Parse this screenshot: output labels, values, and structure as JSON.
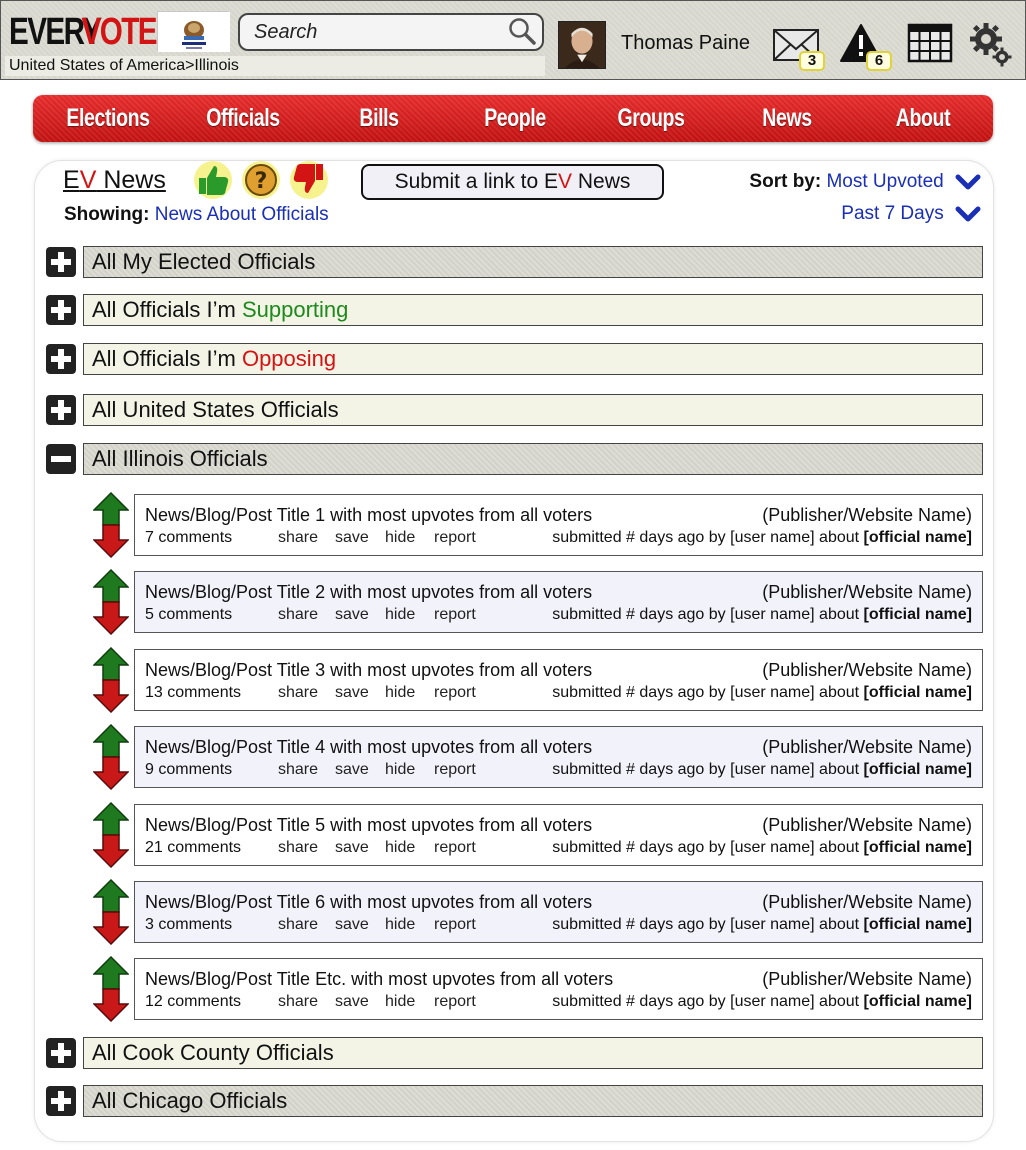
{
  "header": {
    "logo_every": "EVERY",
    "logo_vote": "VOTE",
    "breadcrumb": "United States of America>Illinois",
    "search_placeholder": "Search",
    "user_name": "Thomas Paine",
    "messages_count": "3",
    "alerts_count": "6"
  },
  "nav": {
    "items": [
      "Elections",
      "Officials",
      "Bills",
      "People",
      "Groups",
      "News",
      "About"
    ]
  },
  "news_header": {
    "title_e": "E",
    "title_v": "V",
    "title_rest": " News",
    "submit_prefix": "Submit a link to E",
    "submit_v": "V",
    "submit_suffix": " News",
    "showing_label": "Showing:",
    "showing_value": "News About Officials",
    "sort_label": "Sort by:",
    "sort_value": "Most Upvoted",
    "period_value": "Past 7 Days"
  },
  "sections": [
    {
      "prefix": "All My Elected Officials",
      "highlight": "",
      "state": "+"
    },
    {
      "prefix": "All Officials I’m ",
      "highlight": "Supporting",
      "state": "+"
    },
    {
      "prefix": "All Officials I’m ",
      "highlight": "Opposing",
      "state": "+"
    },
    {
      "prefix": "All United States Officials",
      "highlight": "",
      "state": "+"
    },
    {
      "prefix": "All Illinois Officials",
      "highlight": "",
      "state": "-"
    },
    {
      "prefix": "All Cook County Officials",
      "highlight": "",
      "state": "+"
    },
    {
      "prefix": "All Chicago Officials",
      "highlight": "",
      "state": "+"
    }
  ],
  "news_items": [
    {
      "title": "News/Blog/Post Title 1 with most upvotes from all voters",
      "comments": "7 comments"
    },
    {
      "title": "News/Blog/Post Title 2 with most upvotes from all voters",
      "comments": "5 comments"
    },
    {
      "title": "News/Blog/Post Title 3 with most upvotes from all voters",
      "comments": "13 comments"
    },
    {
      "title": "News/Blog/Post Title 4 with most upvotes from all voters",
      "comments": "9 comments"
    },
    {
      "title": "News/Blog/Post Title 5 with most upvotes from all voters",
      "comments": "21 comments"
    },
    {
      "title": "News/Blog/Post Title 6 with most upvotes from all voters",
      "comments": "3 comments"
    },
    {
      "title": "News/Blog/Post Title Etc. with most upvotes from all voters",
      "comments": "12 comments"
    }
  ],
  "news_common": {
    "publisher": "(Publisher/Website Name)",
    "share": "share",
    "save": "save",
    "hide": "hide",
    "report": "report",
    "submitted": "submitted # days ago by [user name] about ",
    "official": "[official name]"
  },
  "icons": {
    "thumbs_up": "thumbs-up-icon",
    "question": "question-icon",
    "thumbs_down": "thumbs-down-icon",
    "mail": "mail-icon",
    "alert": "alert-icon",
    "calendar": "calendar-icon",
    "settings": "gear-icon"
  },
  "colors": {
    "brand_red": "#d21414",
    "link_blue": "#1a2fb5",
    "supporting_green": "#1c8a1c"
  }
}
